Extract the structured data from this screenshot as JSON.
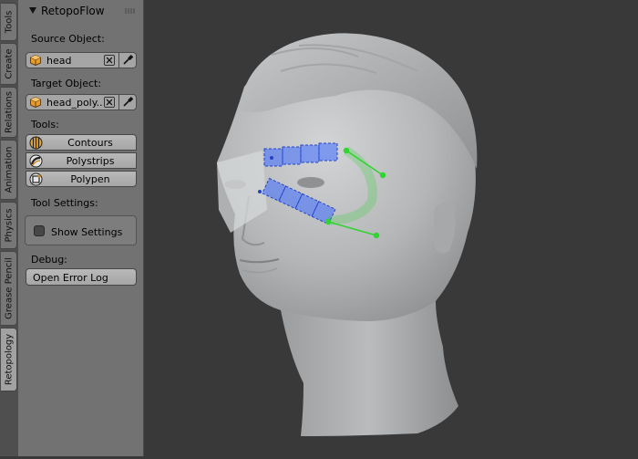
{
  "tabs": [
    "Tools",
    "Create",
    "Relations",
    "Animation",
    "Physics",
    "Grease Pencil",
    "Retopology"
  ],
  "panel": {
    "title": "RetopoFlow",
    "source_label": "Source Object:",
    "source_value": "head",
    "target_label": "Target Object:",
    "target_value": "head_poly...",
    "tools_label": "Tools:",
    "tools": [
      "Contours",
      "Polystrips",
      "Polypen"
    ],
    "tool_settings_label": "Tool Settings:",
    "show_settings_label": "Show Settings",
    "show_settings_checked": false,
    "debug_label": "Debug:",
    "error_log_button": "Open Error Log"
  },
  "colors": {
    "viewport_background": "#393939",
    "polystrip_blue": "#3d6bff",
    "contour_green": "#2fd42f",
    "object_icon_orange": "#e89a2c"
  },
  "icons": [
    "cube-icon",
    "clear-x-icon",
    "eyedropper-icon",
    "contours-icon",
    "polystrips-icon",
    "polypen-icon"
  ]
}
